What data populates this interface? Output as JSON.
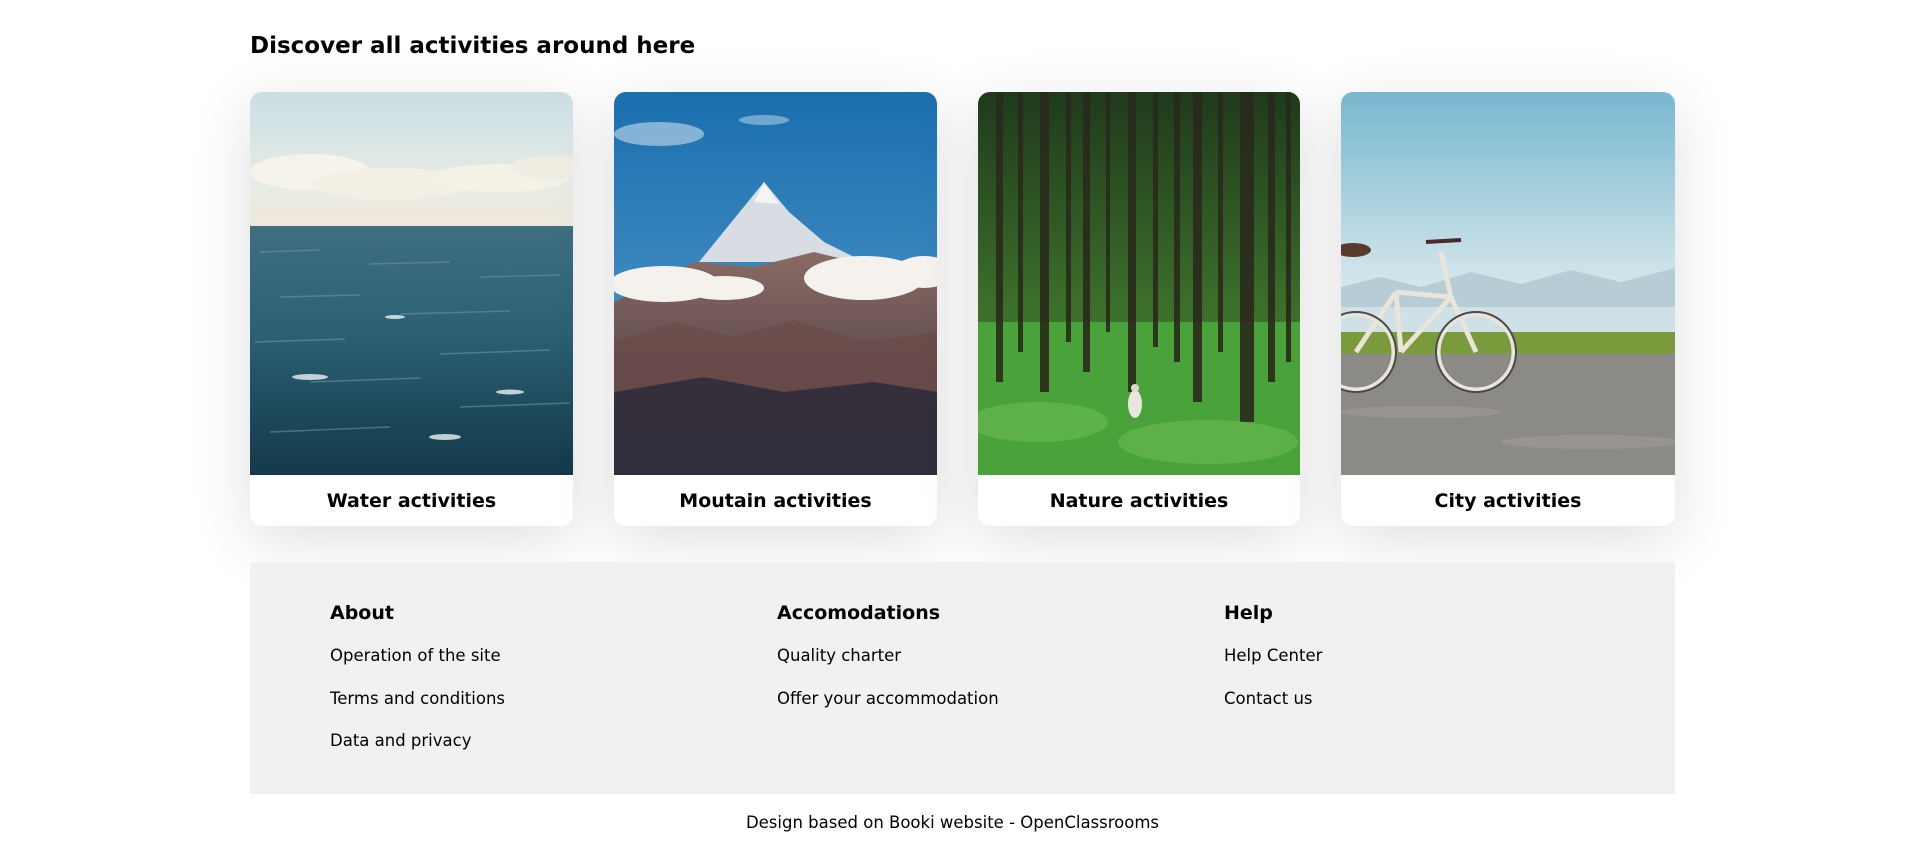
{
  "section": {
    "title": "Discover all activities around here"
  },
  "cards": [
    {
      "label": "Water activities"
    },
    {
      "label": "Moutain activities"
    },
    {
      "label": "Nature activities"
    },
    {
      "label": "City activities"
    }
  ],
  "footer": {
    "columns": [
      {
        "title": "About",
        "links": [
          "Operation of the site",
          "Terms and conditions",
          "Data and privacy"
        ]
      },
      {
        "title": "Accomodations",
        "links": [
          "Quality charter",
          "Offer your accommodation"
        ]
      },
      {
        "title": "Help",
        "links": [
          "Help Center",
          "Contact us"
        ]
      }
    ]
  },
  "credit": "Design based on Booki website - OpenClassrooms"
}
